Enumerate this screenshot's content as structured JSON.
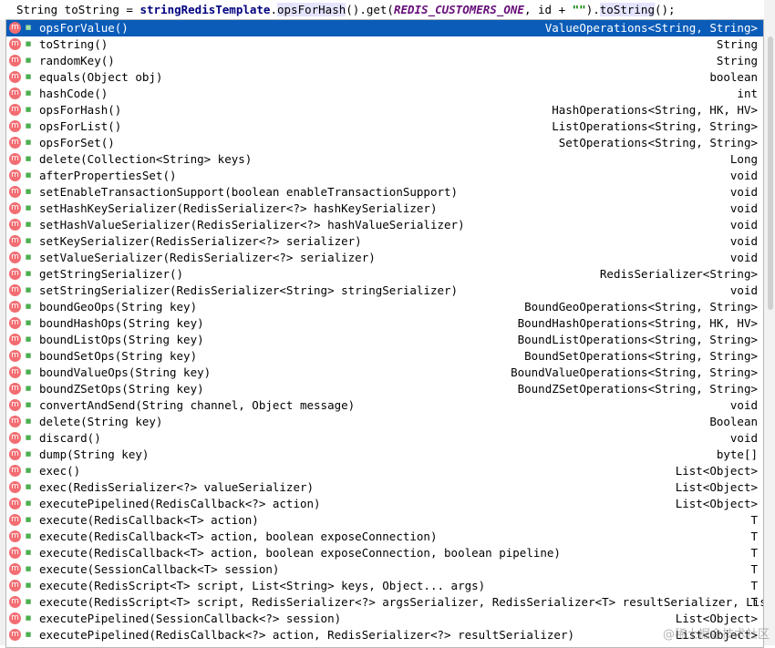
{
  "editor": {
    "code_prefix": "String toString = ",
    "code_template": "stringRedisTemplate",
    "code_dot1": ".",
    "code_method1": "opsForHash",
    "code_mid": "().get(",
    "code_const": "REDIS_CUSTOMERS_ONE",
    "code_mid2": ", id + ",
    "code_str": "\"\"",
    "code_close": ").",
    "code_method2": "toString",
    "code_end": "();"
  },
  "completion_items": [
    {
      "signature": "opsForValue()",
      "return_type": "ValueOperations<String, String>",
      "selected": true
    },
    {
      "signature": "toString()",
      "return_type": "String"
    },
    {
      "signature": "randomKey()",
      "return_type": "String"
    },
    {
      "signature": "equals(Object obj)",
      "return_type": "boolean"
    },
    {
      "signature": "hashCode()",
      "return_type": "int"
    },
    {
      "signature": "opsForHash()",
      "return_type": "HashOperations<String, HK, HV>"
    },
    {
      "signature": "opsForList()",
      "return_type": "ListOperations<String, String>"
    },
    {
      "signature": "opsForSet()",
      "return_type": "SetOperations<String, String>"
    },
    {
      "signature": "delete(Collection<String> keys)",
      "return_type": "Long"
    },
    {
      "signature": "afterPropertiesSet()",
      "return_type": "void"
    },
    {
      "signature": "setEnableTransactionSupport(boolean enableTransactionSupport)",
      "return_type": "void"
    },
    {
      "signature": "setHashKeySerializer(RedisSerializer<?> hashKeySerializer)",
      "return_type": "void"
    },
    {
      "signature": "setHashValueSerializer(RedisSerializer<?> hashValueSerializer)",
      "return_type": "void"
    },
    {
      "signature": "setKeySerializer(RedisSerializer<?> serializer)",
      "return_type": "void"
    },
    {
      "signature": "setValueSerializer(RedisSerializer<?> serializer)",
      "return_type": "void"
    },
    {
      "signature": "getStringSerializer()",
      "return_type": "RedisSerializer<String>"
    },
    {
      "signature": "setStringSerializer(RedisSerializer<String> stringSerializer)",
      "return_type": "void"
    },
    {
      "signature": "boundGeoOps(String key)",
      "return_type": "BoundGeoOperations<String, String>"
    },
    {
      "signature": "boundHashOps(String key)",
      "return_type": "BoundHashOperations<String, HK, HV>"
    },
    {
      "signature": "boundListOps(String key)",
      "return_type": "BoundListOperations<String, String>"
    },
    {
      "signature": "boundSetOps(String key)",
      "return_type": "BoundSetOperations<String, String>"
    },
    {
      "signature": "boundValueOps(String key)",
      "return_type": "BoundValueOperations<String, String>"
    },
    {
      "signature": "boundZSetOps(String key)",
      "return_type": "BoundZSetOperations<String, String>"
    },
    {
      "signature": "convertAndSend(String channel, Object message)",
      "return_type": "void"
    },
    {
      "signature": "delete(String key)",
      "return_type": "Boolean"
    },
    {
      "signature": "discard()",
      "return_type": "void"
    },
    {
      "signature": "dump(String key)",
      "return_type": "byte[]"
    },
    {
      "signature": "exec()",
      "return_type": "List<Object>"
    },
    {
      "signature": "exec(RedisSerializer<?> valueSerializer)",
      "return_type": "List<Object>"
    },
    {
      "signature": "executePipelined(RedisCallback<?> action)",
      "return_type": "List<Object>"
    },
    {
      "signature": "execute(RedisCallback<T> action)",
      "return_type": "T"
    },
    {
      "signature": "execute(RedisCallback<T> action, boolean exposeConnection)",
      "return_type": "T"
    },
    {
      "signature": "execute(RedisCallback<T> action, boolean exposeConnection, boolean pipeline)",
      "return_type": "T"
    },
    {
      "signature": "execute(SessionCallback<T> session)",
      "return_type": "T"
    },
    {
      "signature": "execute(RedisScript<T> script, List<String> keys, Object... args)",
      "return_type": "T"
    },
    {
      "signature": "execute(RedisScript<T> script, RedisSerializer<?> argsSerializer, RedisSerializer<T> resultSerializer, List<St…",
      "return_type": "T"
    },
    {
      "signature": "executePipelined(SessionCallback<?> session)",
      "return_type": "List<Object>"
    },
    {
      "signature": "executePipelined(RedisCallback<?> action, RedisSerializer<?> resultSerializer)",
      "return_type": "List<Object>"
    }
  ],
  "icons": {
    "method": "method-icon",
    "visibility": "public-visibility-icon"
  },
  "colors": {
    "selection": "#0a5cb8",
    "method_icon": "#f26d72"
  },
  "watermark": "@稀土掘金技术社区"
}
